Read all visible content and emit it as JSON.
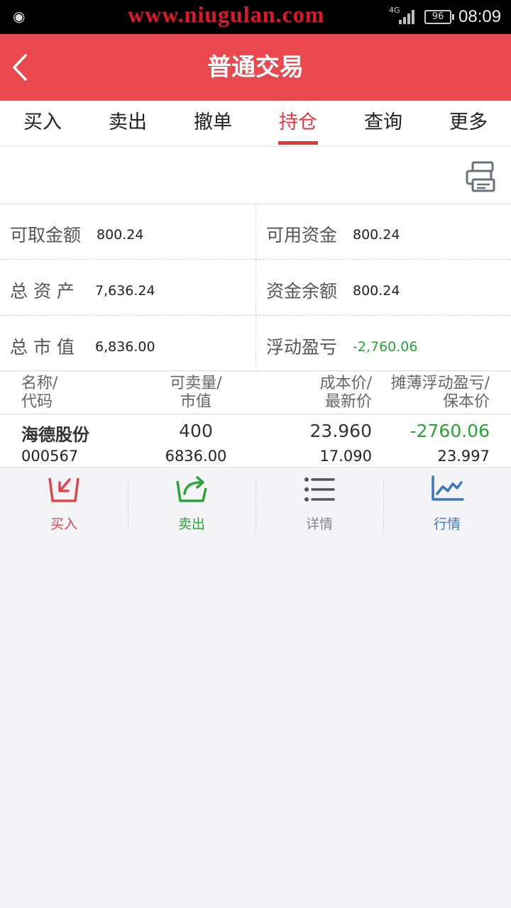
{
  "status_bar": {
    "watermark": "www.niugulan.com",
    "network": "4G",
    "battery": "96",
    "time": "08:09"
  },
  "header": {
    "title": "普通交易"
  },
  "tabs": [
    {
      "label": "买入"
    },
    {
      "label": "卖出"
    },
    {
      "label": "撤单"
    },
    {
      "label": "持仓",
      "active": true
    },
    {
      "label": "查询"
    },
    {
      "label": "更多"
    }
  ],
  "assets": {
    "withdrawable": {
      "label": "可取金额",
      "value": "800.24"
    },
    "available": {
      "label": "可用资金",
      "value": "800.24"
    },
    "total_assets": {
      "label": "总 资 产",
      "value": "7,636.24"
    },
    "fund_balance": {
      "label": "资金余额",
      "value": "800.24"
    },
    "market_value": {
      "label": "总 市 值",
      "value": "6,836.00"
    },
    "floating_pl": {
      "label": "浮动盈亏",
      "value": "-2,760.06"
    }
  },
  "table": {
    "headers": {
      "col1": [
        "名称/",
        "代码"
      ],
      "col2": [
        "可卖量/",
        "市值"
      ],
      "col3": [
        "成本价/",
        "最新价"
      ],
      "col4": [
        "摊薄浮动盈亏/",
        "保本价"
      ]
    },
    "rows": [
      {
        "name": "海德股份",
        "code": "000567",
        "sellable": "400",
        "market_value": "6836.00",
        "cost": "23.960",
        "last": "17.090",
        "pl": "-2760.06",
        "breakeven": "23.997"
      }
    ]
  },
  "actions": [
    {
      "label": "买入",
      "icon": "buy-icon",
      "color": "#e0474c"
    },
    {
      "label": "卖出",
      "icon": "sell-icon",
      "color": "#2aa43a"
    },
    {
      "label": "详情",
      "icon": "list-icon",
      "color": "#888888"
    },
    {
      "label": "行情",
      "icon": "chart-line-icon",
      "color": "#3a78c2"
    }
  ],
  "colors": {
    "brand": "#e8484e",
    "active_tab": "#e03a3f",
    "loss": "#2aa43a"
  }
}
